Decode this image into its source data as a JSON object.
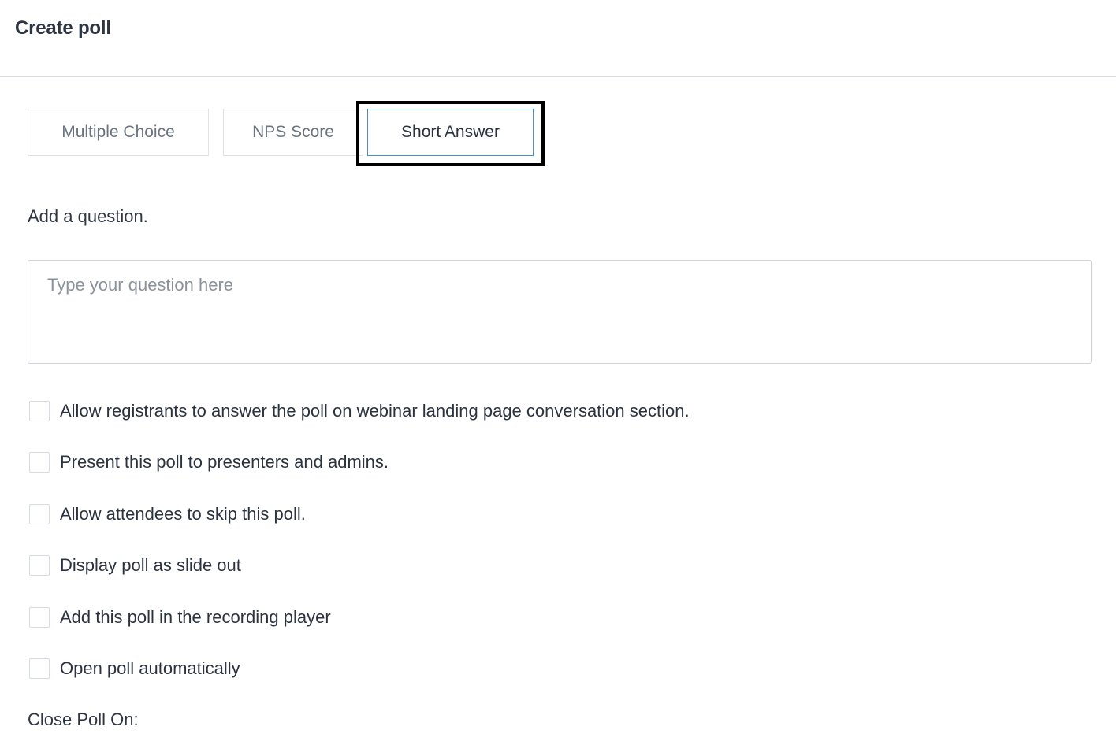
{
  "header": {
    "title": "Create poll"
  },
  "tabs": [
    {
      "label": "Multiple Choice",
      "selected": false
    },
    {
      "label": "NPS Score",
      "selected": false
    },
    {
      "label": "Short Answer",
      "selected": true
    }
  ],
  "question": {
    "label": "Add a question.",
    "placeholder": "Type your question here",
    "value": ""
  },
  "options": [
    {
      "label": "Allow registrants to answer the poll on webinar landing page conversation section.",
      "checked": false
    },
    {
      "label": "Present this poll to presenters and admins.",
      "checked": false
    },
    {
      "label": "Allow attendees to skip this poll.",
      "checked": false
    },
    {
      "label": "Display poll as slide out",
      "checked": false
    },
    {
      "label": "Add this poll in the recording player",
      "checked": false
    },
    {
      "label": "Open poll automatically",
      "checked": false
    }
  ],
  "close_poll": {
    "label": "Close Poll On:"
  },
  "colors": {
    "selected_tab_border": "#4a90d9",
    "focus_ring": "#000000",
    "text": "#2b3340",
    "muted_text": "#6b7480"
  }
}
